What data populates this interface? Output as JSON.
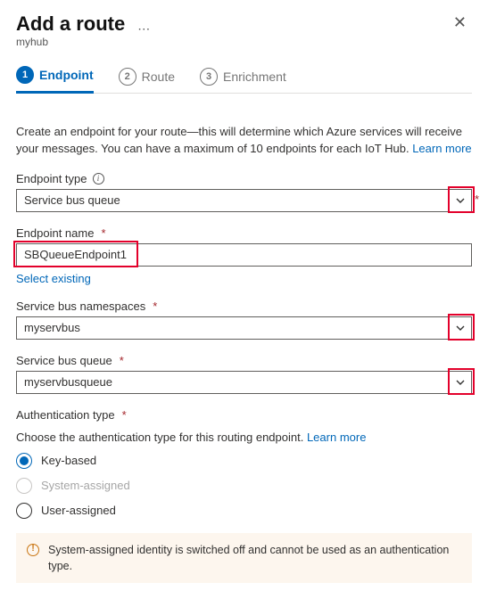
{
  "header": {
    "title": "Add a route",
    "subtitle": "myhub"
  },
  "steps": {
    "s1": {
      "num": "1",
      "label": "Endpoint"
    },
    "s2": {
      "num": "2",
      "label": "Route"
    },
    "s3": {
      "num": "3",
      "label": "Enrichment"
    }
  },
  "desc": {
    "textA": "Create an endpoint for your route—this will determine which Azure services will receive your messages. You can have a maximum of 10 endpoints for each IoT Hub. ",
    "learn": "Learn more"
  },
  "fields": {
    "endpoint_type": {
      "label": "Endpoint type",
      "value": "Service bus queue"
    },
    "endpoint_name": {
      "label": "Endpoint name",
      "value": "SBQueueEndpoint1",
      "select_existing": "Select existing"
    },
    "namespaces": {
      "label": "Service bus namespaces",
      "value": "myservbus"
    },
    "queue": {
      "label": "Service bus queue",
      "value": "myservbusqueue"
    },
    "auth": {
      "label": "Authentication type",
      "hint": "Choose the authentication type for this routing endpoint. ",
      "learn": "Learn more",
      "opt_key": "Key-based",
      "opt_system": "System-assigned",
      "opt_user": "User-assigned"
    }
  },
  "warning": "System-assigned identity is switched off and cannot be used as an authentication type."
}
